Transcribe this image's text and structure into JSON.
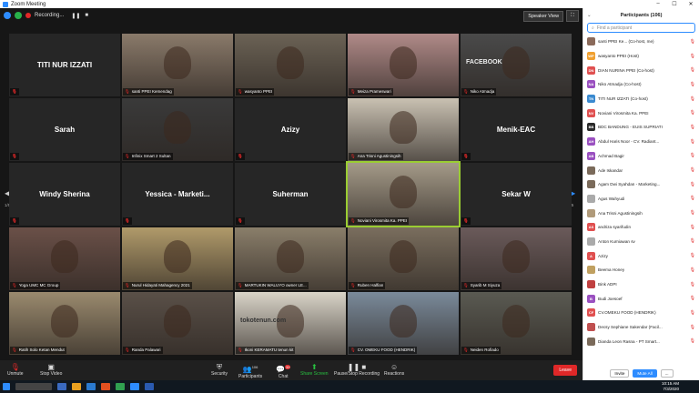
{
  "window": {
    "title": "Zoom Meeting"
  },
  "topbar": {
    "recording": "Recording...",
    "speaker_view": "Speaker View"
  },
  "pagination": {
    "left": "1/5",
    "right": "1/5"
  },
  "tiles": [
    {
      "name": "TITI NUR IZZATI",
      "label": "",
      "mode": "name"
    },
    {
      "name": "",
      "label": "santi PPEI Kemendag",
      "mode": "video",
      "bg": "#8a7a6a"
    },
    {
      "name": "",
      "label": "wasyanto PPEI",
      "mode": "video",
      "bg": "#6b6255"
    },
    {
      "name": "",
      "label": "Meiza Prameswari",
      "mode": "video",
      "bg": "#b08a88"
    },
    {
      "name": "FACEBOOK",
      "label": "Niko Atmadja",
      "mode": "video",
      "bg": "#4a4a4a"
    },
    {
      "name": "Sarah",
      "label": "",
      "mode": "name"
    },
    {
      "name": "",
      "label": "Infinix Smart 2 Sultan",
      "mode": "video",
      "bg": "#3a3a3a"
    },
    {
      "name": "Azizy",
      "label": "",
      "mode": "name"
    },
    {
      "name": "",
      "label": "Ana Trisni Agustiningsih",
      "mode": "video",
      "bg": "#c9c1b2"
    },
    {
      "name": "Menik-EAC",
      "label": "",
      "mode": "name"
    },
    {
      "name": "Windy Sherina",
      "label": "",
      "mode": "name"
    },
    {
      "name": "Yessica - Marketi...",
      "label": "",
      "mode": "name"
    },
    {
      "name": "Suherman",
      "label": "",
      "mode": "name"
    },
    {
      "name": "",
      "label": "Noviani Virosmita Ka. PPEI",
      "mode": "video",
      "bg": "#a49a88",
      "active": true
    },
    {
      "name": "Sekar W",
      "label": "",
      "mode": "name"
    },
    {
      "name": "",
      "label": "Yoga UMC MC Group",
      "mode": "video",
      "bg": "#6a5048"
    },
    {
      "name": "",
      "label": "Nurul Hidayati Mahagency 2021",
      "mode": "video",
      "bg": "#b09a6a"
    },
    {
      "name": "",
      "label": "MARTUKIN WALUYO owner LE...",
      "mode": "video",
      "bg": "#8a7e6a"
    },
    {
      "name": "",
      "label": "Ruben Halfian",
      "mode": "video",
      "bg": "#7a6e5e"
    },
    {
      "name": "",
      "label": "Syarib M Siyuza",
      "mode": "video",
      "bg": "#6a5a5a"
    },
    {
      "name": "",
      "label": "Ratih Solo Ketan Mendut",
      "mode": "video",
      "bg": "#9a8a6e"
    },
    {
      "name": "",
      "label": "Randa Palawari",
      "mode": "video",
      "bg": "#5a5048"
    },
    {
      "name": "tokotenun.com",
      "label": "Ikoni KERAMATU tenun kit",
      "mode": "video",
      "bg": "#d9d4c8"
    },
    {
      "name": "",
      "label": "CV. OMEKU FOOD (HENDRIK)",
      "mode": "video",
      "bg": "#7a8a9a"
    },
    {
      "name": "",
      "label": "Neiden Rofiado",
      "mode": "video",
      "bg": "#5a5a52"
    }
  ],
  "bottombar": {
    "unmute": "Unmute",
    "stop_video": "Stop Video",
    "security": "Security",
    "participants": "Participants",
    "participants_count": "106",
    "chat": "Chat",
    "chat_badge": "39",
    "share_screen": "Share Screen",
    "record": "Pause/Stop Recording",
    "reactions": "Reactions",
    "leave": "Leave"
  },
  "panel": {
    "title": "Participants (106)",
    "search_placeholder": "Find a participant",
    "invite": "Invite",
    "mute_all": "Mute All",
    "more": "..."
  },
  "participants": [
    {
      "initials": "",
      "name": "santi PPEI Ke...  (Co-host, me)",
      "color": "#8a6a5a"
    },
    {
      "initials": "WP",
      "name": "wasyanto PPEI (Host)",
      "color": "#f0a030"
    },
    {
      "initials": "DN",
      "name": "DIAN NURINA PPEI (Co-host)",
      "color": "#e05050"
    },
    {
      "initials": "NA",
      "name": "Niko Atmadja (Co-host)",
      "color": "#9a50c0"
    },
    {
      "initials": "TN",
      "name": "TITI NUR IZZATI (Co-host)",
      "color": "#3a8ad0"
    },
    {
      "initials": "NV",
      "name": "Noviani Virosmita Ka. PPEI",
      "color": "#e05050"
    },
    {
      "initials": "BB",
      "name": "BDC BANDUNG - EUIS SUPRIATI",
      "color": "#2a2a2a"
    },
    {
      "initials": "AH",
      "name": "Abdul Haris Noor - CV. Radiant...",
      "color": "#9a50c0"
    },
    {
      "initials": "AB",
      "name": "Achmad Bagir",
      "color": "#9a50c0"
    },
    {
      "initials": "",
      "name": "Ade Iskandar",
      "color": "#7a6a5a"
    },
    {
      "initials": "",
      "name": "Agam Dwi Syahdan - Marketing...",
      "color": "#7a6a5a"
    },
    {
      "initials": "",
      "name": "Agus Wahyudi",
      "color": "#aaaaaa"
    },
    {
      "initials": "",
      "name": "Ana Trisni Agustiningsih",
      "color": "#b09a7a"
    },
    {
      "initials": "AS",
      "name": "andriza syarifudin",
      "color": "#e05050"
    },
    {
      "initials": "",
      "name": "Anton Kurniawan sv",
      "color": "#aaaaaa"
    },
    {
      "initials": "A",
      "name": "Azizy",
      "color": "#e05050"
    },
    {
      "initials": "",
      "name": "Beema Honey",
      "color": "#c0a060"
    },
    {
      "initials": "",
      "name": "Bink ADPI",
      "color": "#c04040"
    },
    {
      "initials": "B",
      "name": "Budi Joesoef",
      "color": "#9a50c0"
    },
    {
      "initials": "CF",
      "name": "CV.OMEKU FOOD (HENDRIK)",
      "color": "#e05050"
    },
    {
      "initials": "",
      "name": "Decsy Sephiane Sakendar (Facil...",
      "color": "#c05050"
    },
    {
      "initials": "",
      "name": "Dianda Leon Rasna - PT Smart...",
      "color": "#7a6a5a"
    }
  ],
  "taskbar": {
    "time": "10:15 AM",
    "date": "7/3/2020"
  }
}
